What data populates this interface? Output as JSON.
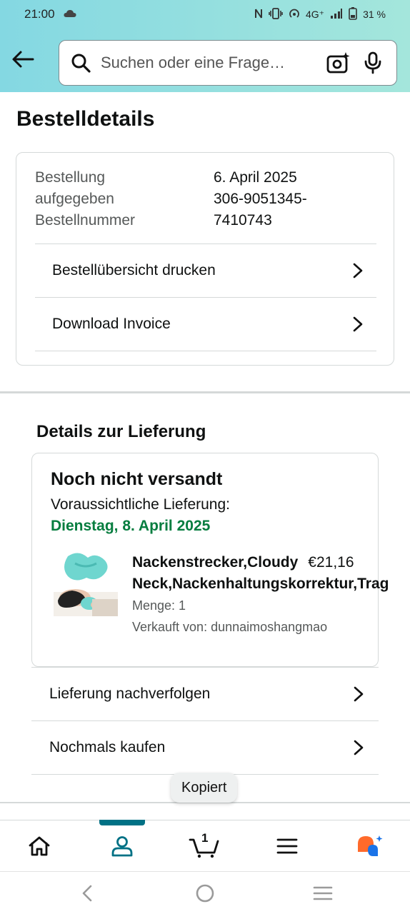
{
  "status_bar": {
    "time": "21:00",
    "network": "4G⁺",
    "battery": "31 %"
  },
  "search": {
    "placeholder": "Suchen oder eine Frage…"
  },
  "page": {
    "title": "Bestelldetails"
  },
  "order": {
    "placed_label": "Bestellung aufgegeben",
    "placed_value": "6. April 2025",
    "number_label": "Bestellnummer",
    "number_value": "306-9051345-7410743",
    "links": [
      {
        "label": "Bestellübersicht drucken"
      },
      {
        "label": "Download Invoice"
      }
    ]
  },
  "delivery": {
    "section_title": "Details zur Lieferung",
    "status": "Noch nicht versandt",
    "eta_label": "Voraussichtliche Lieferung:",
    "eta_date": "Dienstag, 8. April 2025",
    "product": {
      "name_line1": "Nackenstrecker,Cloudy",
      "price": "€21,16",
      "name_line2": "Neck,Nackenhaltungskorrektur,Trag",
      "quantity": "Menge: 1",
      "seller": "Verkauft von: dunnaimoshangmao"
    },
    "links": [
      {
        "label": "Lieferung nachverfolgen"
      },
      {
        "label": "Nochmals kaufen"
      }
    ]
  },
  "toast": {
    "text": "Kopiert"
  },
  "bottom_nav": {
    "items": [
      {
        "icon": "home-icon"
      },
      {
        "icon": "account-icon",
        "active": true
      },
      {
        "icon": "cart-icon",
        "count": "1"
      },
      {
        "icon": "menu-icon"
      },
      {
        "icon": "rufus-assistant-icon"
      }
    ],
    "accent_color": "#007185"
  },
  "colors": {
    "header_gradient_start": "#84d8e2",
    "header_gradient_end": "#a4e6dc",
    "delivery_date_green": "#067d3f",
    "assistant_orange": "#ff6a2b",
    "assistant_blue": "#1a73e8"
  }
}
